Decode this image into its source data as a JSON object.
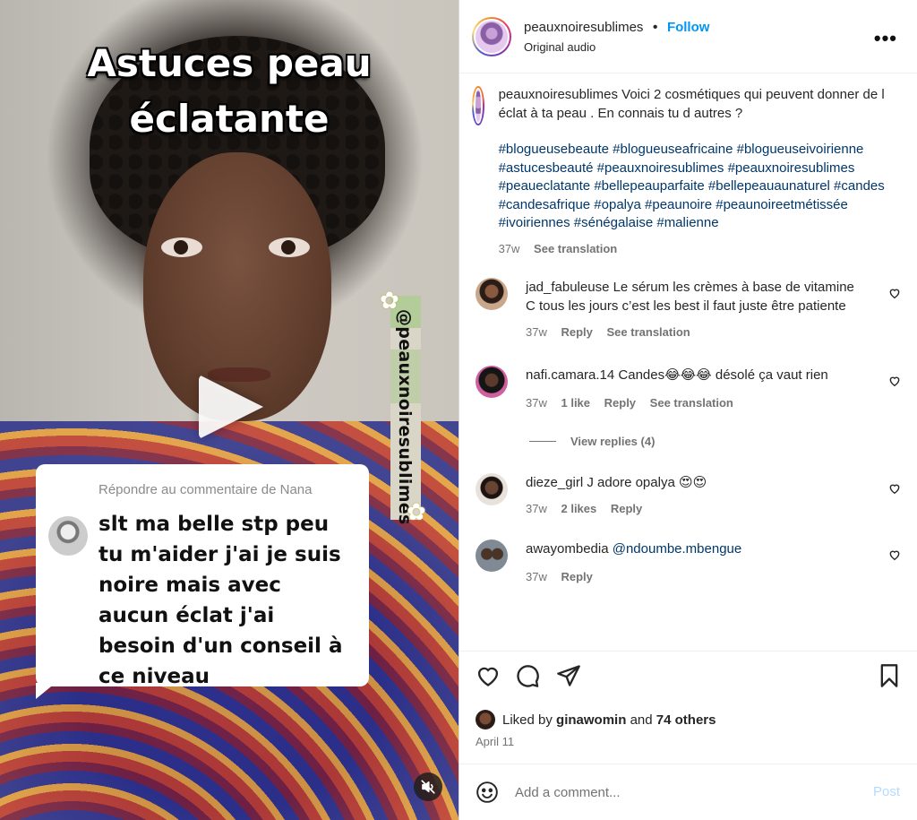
{
  "media": {
    "overlay_title_line1": "Astuces peau",
    "overlay_title_line2": "éclatante",
    "vertical_handle": "@peauxnoiresublimes",
    "reply_card": {
      "label": "Répondre au commentaire de Nana",
      "text": "slt ma belle stp peu tu m'aider j'ai je suis noire mais avec aucun éclat j'ai besoin d'un conseil à ce niveau"
    }
  },
  "header": {
    "username": "peauxnoiresublimes",
    "separator": "•",
    "follow_label": "Follow",
    "subtitle": "Original audio",
    "more_label": "•••"
  },
  "caption": {
    "username": "peauxnoiresublimes",
    "text": "Voici 2 cosmétiques qui peuvent donner de l éclat à ta peau . En connais tu d autres ?",
    "hashtags": "#blogueusebeaute #blogueuseafricaine #blogueuseivoirienne #astucesbeauté #peauxnoiresublimes #peauxnoiresublimes #peaueclatante #bellepeauparfaite #bellepeauaunaturel #candes #candesafrique #opalya #peaunoire #peaunoireetmétissée #ivoiriennes #sénégalaise #malienne",
    "time": "37w",
    "see_translation": "See translation"
  },
  "comments": [
    {
      "username": "jad_fabuleuse",
      "text": "Le sérum les crèmes à base de vitamine C tous les jours c’est les best il faut juste être patiente",
      "time": "37w",
      "likes": "",
      "reply": "Reply",
      "see_translation": "See translation"
    },
    {
      "username": "nafi.camara.14",
      "text": "Candes😂😂😂 désolé ça vaut rien",
      "time": "37w",
      "likes": "1 like",
      "reply": "Reply",
      "see_translation": "See translation",
      "view_replies": "View replies (4)"
    },
    {
      "username": "dieze_girl",
      "text": "J adore opalya 😍😍",
      "time": "37w",
      "likes": "2 likes",
      "reply": "Reply"
    },
    {
      "username": "awayombedia",
      "text": "@ndoumbe.mbengue",
      "time": "37w",
      "reply": "Reply"
    }
  ],
  "likes": {
    "prefix": "Liked by",
    "user": "ginawomin",
    "and": "and",
    "others": "74 others"
  },
  "date": "April 11",
  "add_comment": {
    "placeholder": "Add a comment...",
    "post_label": "Post"
  }
}
